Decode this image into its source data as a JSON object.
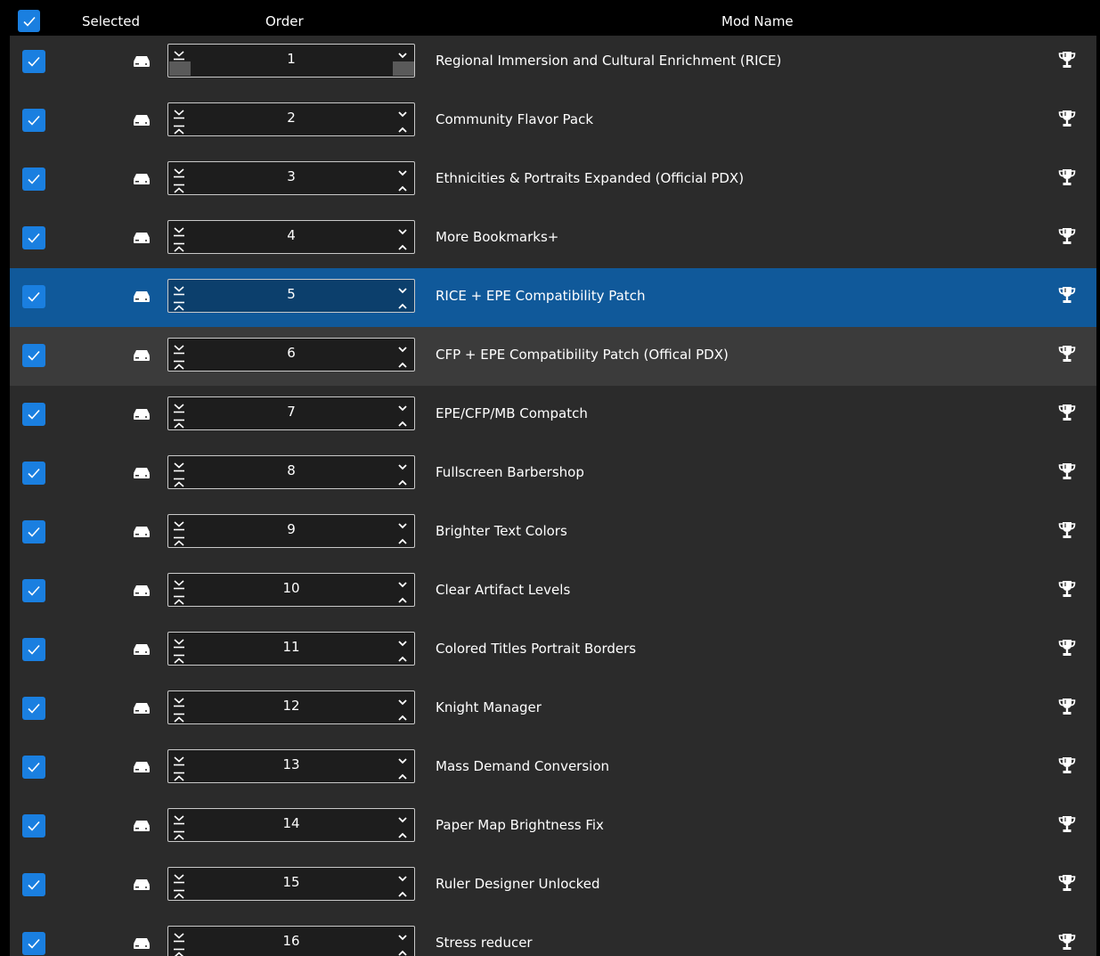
{
  "header": {
    "selected_label": "Selected",
    "order_label": "Order",
    "name_label": "Mod Name"
  },
  "colors": {
    "accent": "#1a7fe0",
    "selected_row": "#10599a",
    "hover_row": "#3b3b3b",
    "grid_bg": "#2b2b2b"
  },
  "icons": {
    "checkbox": "check-icon",
    "source": "hard-drive-icon",
    "order_top": "move-to-top-icon",
    "order_bottom": "move-to-bottom-icon",
    "order_up": "chevron-up-icon",
    "order_down": "chevron-down-icon",
    "trophy": "trophy-icon"
  },
  "mods": [
    {
      "order": "1",
      "name": "Regional Immersion and Cultural Enrichment (RICE)",
      "checked": true
    },
    {
      "order": "2",
      "name": "Community Flavor Pack",
      "checked": true
    },
    {
      "order": "3",
      "name": "Ethnicities & Portraits Expanded (Official PDX)",
      "checked": true
    },
    {
      "order": "4",
      "name": "More Bookmarks+",
      "checked": true
    },
    {
      "order": "5",
      "name": "RICE + EPE Compatibility Patch",
      "checked": true,
      "state": "selected"
    },
    {
      "order": "6",
      "name": "CFP + EPE Compatibility Patch (Offical PDX)",
      "checked": true,
      "state": "hover"
    },
    {
      "order": "7",
      "name": "EPE/CFP/MB Compatch",
      "checked": true
    },
    {
      "order": "8",
      "name": "Fullscreen Barbershop",
      "checked": true
    },
    {
      "order": "9",
      "name": "Brighter Text Colors",
      "checked": true
    },
    {
      "order": "10",
      "name": "Clear Artifact Levels",
      "checked": true
    },
    {
      "order": "11",
      "name": "Colored Titles Portrait Borders",
      "checked": true
    },
    {
      "order": "12",
      "name": "Knight Manager",
      "checked": true
    },
    {
      "order": "13",
      "name": "Mass Demand Conversion",
      "checked": true
    },
    {
      "order": "14",
      "name": "Paper Map Brightness Fix",
      "checked": true
    },
    {
      "order": "15",
      "name": "Ruler Designer Unlocked",
      "checked": true
    },
    {
      "order": "16",
      "name": "Stress reducer",
      "checked": true
    }
  ]
}
